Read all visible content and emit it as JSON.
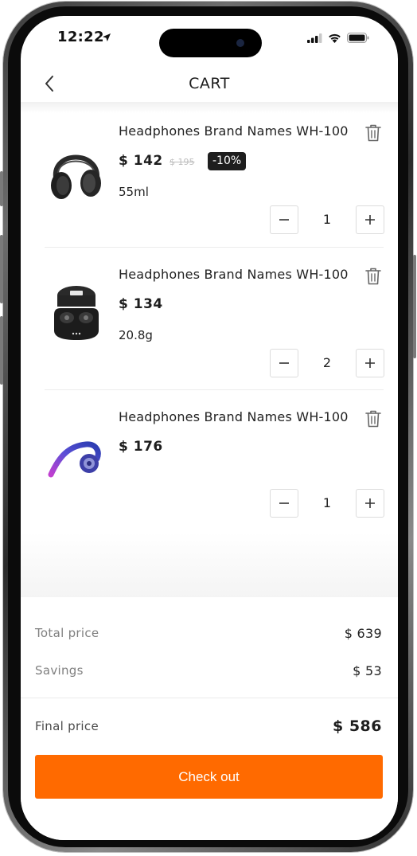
{
  "status_bar": {
    "time": "12:22"
  },
  "header": {
    "title": "CART"
  },
  "items": [
    {
      "name": "Headphones Brand Names WH-100",
      "price": "$ 142",
      "old_price": "$ 195",
      "discount": "-10%",
      "variant": "55ml",
      "quantity": "1",
      "image": "over-ear-headphones"
    },
    {
      "name": "Headphones Brand Names WH-100",
      "price": "$ 134",
      "variant": "20.8g",
      "quantity": "2",
      "image": "earbuds-case"
    },
    {
      "name": "Headphones Brand Names WH-100",
      "price": "$ 176",
      "quantity": "1",
      "image": "ear-hook-headphone"
    }
  ],
  "summary": {
    "total_label": "Total price",
    "total_value": "$ 639",
    "savings_label": "Savings",
    "savings_value": "$ 53",
    "final_label": "Final price",
    "final_value": "$ 586"
  },
  "checkout_label": "Check out",
  "colors": {
    "accent": "#ff6a00",
    "badge": "#1e1e1e",
    "text": "#1e1e1e",
    "muted": "#808080"
  },
  "icons": [
    "location-arrow-icon",
    "signal-icon",
    "wifi-icon",
    "battery-icon",
    "back-chevron-icon",
    "trash-icon",
    "minus-icon",
    "plus-icon"
  ]
}
